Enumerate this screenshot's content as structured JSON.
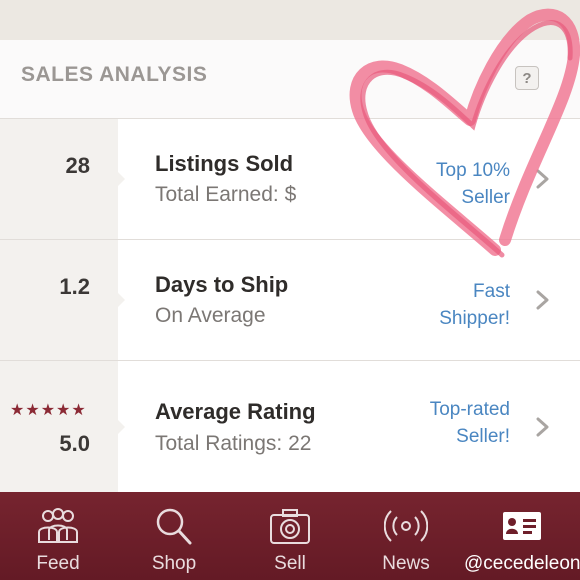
{
  "header": {
    "title": "SALES ANALYSIS",
    "help_label": "?"
  },
  "rows": [
    {
      "value": "28",
      "title": "Listings Sold",
      "subtitle": "Total Earned: $",
      "badge_line1": "Top 10%",
      "badge_line2": "Seller"
    },
    {
      "value": "1.2",
      "title": "Days to Ship",
      "subtitle": "On Average",
      "badge_line1": "Fast",
      "badge_line2": "Shipper!"
    },
    {
      "value": "5.0",
      "stars": "★★★★★",
      "title": "Average Rating",
      "subtitle": "Total Ratings: 22",
      "badge_line1": "Top-rated",
      "badge_line2": "Seller!"
    }
  ],
  "tabs": [
    {
      "label": "Feed",
      "icon": "people-icon"
    },
    {
      "label": "Shop",
      "icon": "search-icon"
    },
    {
      "label": "Sell",
      "icon": "camera-icon"
    },
    {
      "label": "News",
      "icon": "broadcast-icon"
    },
    {
      "label": "@cecedeleon",
      "icon": "profile-card-icon"
    }
  ],
  "colors": {
    "accent_link": "#4a86c1",
    "tabbar_bg": "#6e1f2a",
    "star_color": "#8b2a35",
    "heart_stroke": "#f0728f"
  }
}
